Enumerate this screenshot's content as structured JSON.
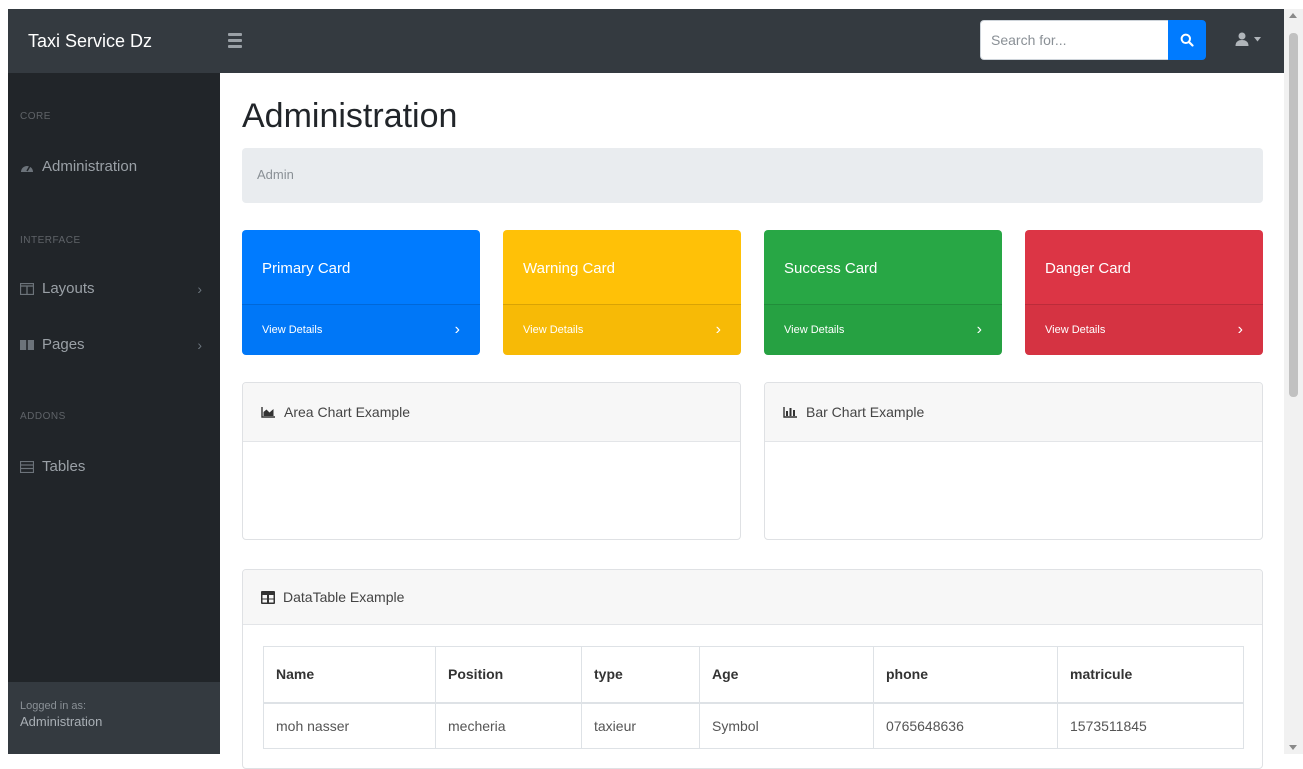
{
  "navbar": {
    "brand": "Taxi Service Dz",
    "search_placeholder": "Search for...",
    "menu_icon": "bars-icon",
    "search_icon": "search-icon",
    "user_icon": "user-icon"
  },
  "sidebar": {
    "headings": {
      "core": "Core",
      "interface": "Interface",
      "addons": "Addons"
    },
    "items": [
      {
        "label": "Administration",
        "icon": "tachometer-icon"
      },
      {
        "label": "Layouts",
        "icon": "columns-icon",
        "chevron": "›"
      },
      {
        "label": "Pages",
        "icon": "book-open-icon",
        "chevron": "›"
      },
      {
        "label": "Tables",
        "icon": "table-icon"
      }
    ],
    "footer": {
      "logged_in_as": "Logged in as:",
      "user": "Administration"
    }
  },
  "main": {
    "title": "Administration",
    "breadcrumb": "Admin",
    "cards": [
      {
        "title": "Primary Card",
        "link": "View Details",
        "chevron": "›",
        "color": "#007bff"
      },
      {
        "title": "Warning Card",
        "link": "View Details",
        "chevron": "›",
        "color": "#ffc107"
      },
      {
        "title": "Success Card",
        "link": "View Details",
        "chevron": "›",
        "color": "#28a745"
      },
      {
        "title": "Danger Card",
        "link": "View Details",
        "chevron": "›",
        "color": "#dc3545"
      }
    ],
    "area_chart": {
      "title": "Area Chart Example",
      "icon": "chart-area-icon"
    },
    "bar_chart": {
      "title": "Bar Chart Example",
      "icon": "chart-bar-icon"
    },
    "datatable": {
      "title": "DataTable Example",
      "icon": "table-icon",
      "columns": [
        "Name",
        "Position",
        "type",
        "Age",
        "phone",
        "matricule"
      ],
      "rows": [
        [
          "moh nasser",
          "mecheria",
          "taxieur",
          "Symbol",
          "0765648636",
          "1573511845"
        ]
      ]
    }
  }
}
